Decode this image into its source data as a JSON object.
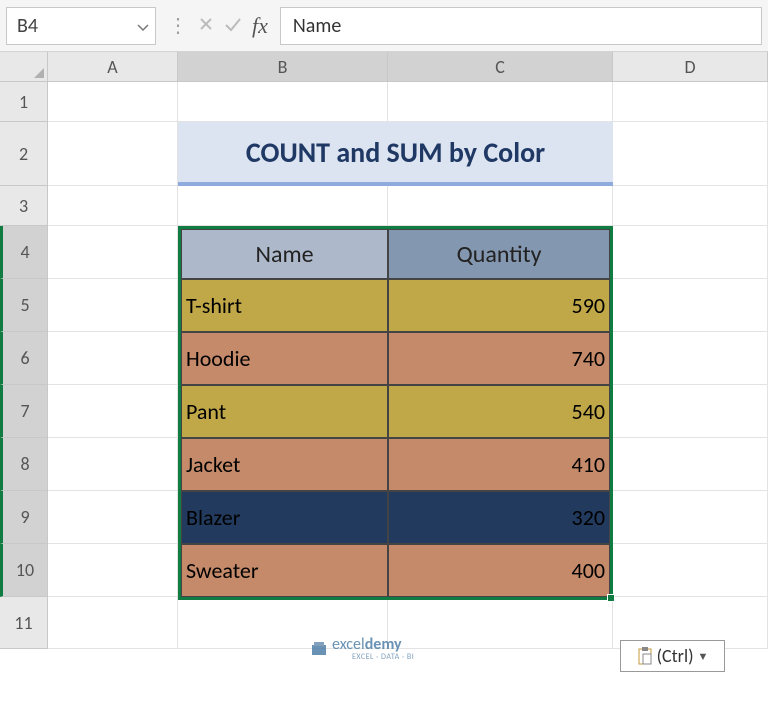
{
  "nameBox": "B4",
  "formula": "Name",
  "columns": [
    "A",
    "B",
    "C",
    "D"
  ],
  "rows": [
    "1",
    "2",
    "3",
    "4",
    "5",
    "6",
    "7",
    "8",
    "9",
    "10",
    "11"
  ],
  "title": "COUNT and SUM by Color",
  "headers": {
    "name": "Name",
    "qty": "Quantity"
  },
  "data": [
    {
      "name": "T-shirt",
      "qty": "590",
      "fill": "gold"
    },
    {
      "name": "Hoodie",
      "qty": "740",
      "fill": "tan"
    },
    {
      "name": "Pant",
      "qty": "540",
      "fill": "gold"
    },
    {
      "name": "Jacket",
      "qty": "410",
      "fill": "tan"
    },
    {
      "name": "Blazer",
      "qty": "320",
      "fill": "navy"
    },
    {
      "name": "Sweater",
      "qty": "400",
      "fill": "tan"
    }
  ],
  "watermark": {
    "brand1": "excel",
    "brand2": "demy",
    "sub": "EXCEL · DATA · BI"
  },
  "smartTag": "(Ctrl)"
}
